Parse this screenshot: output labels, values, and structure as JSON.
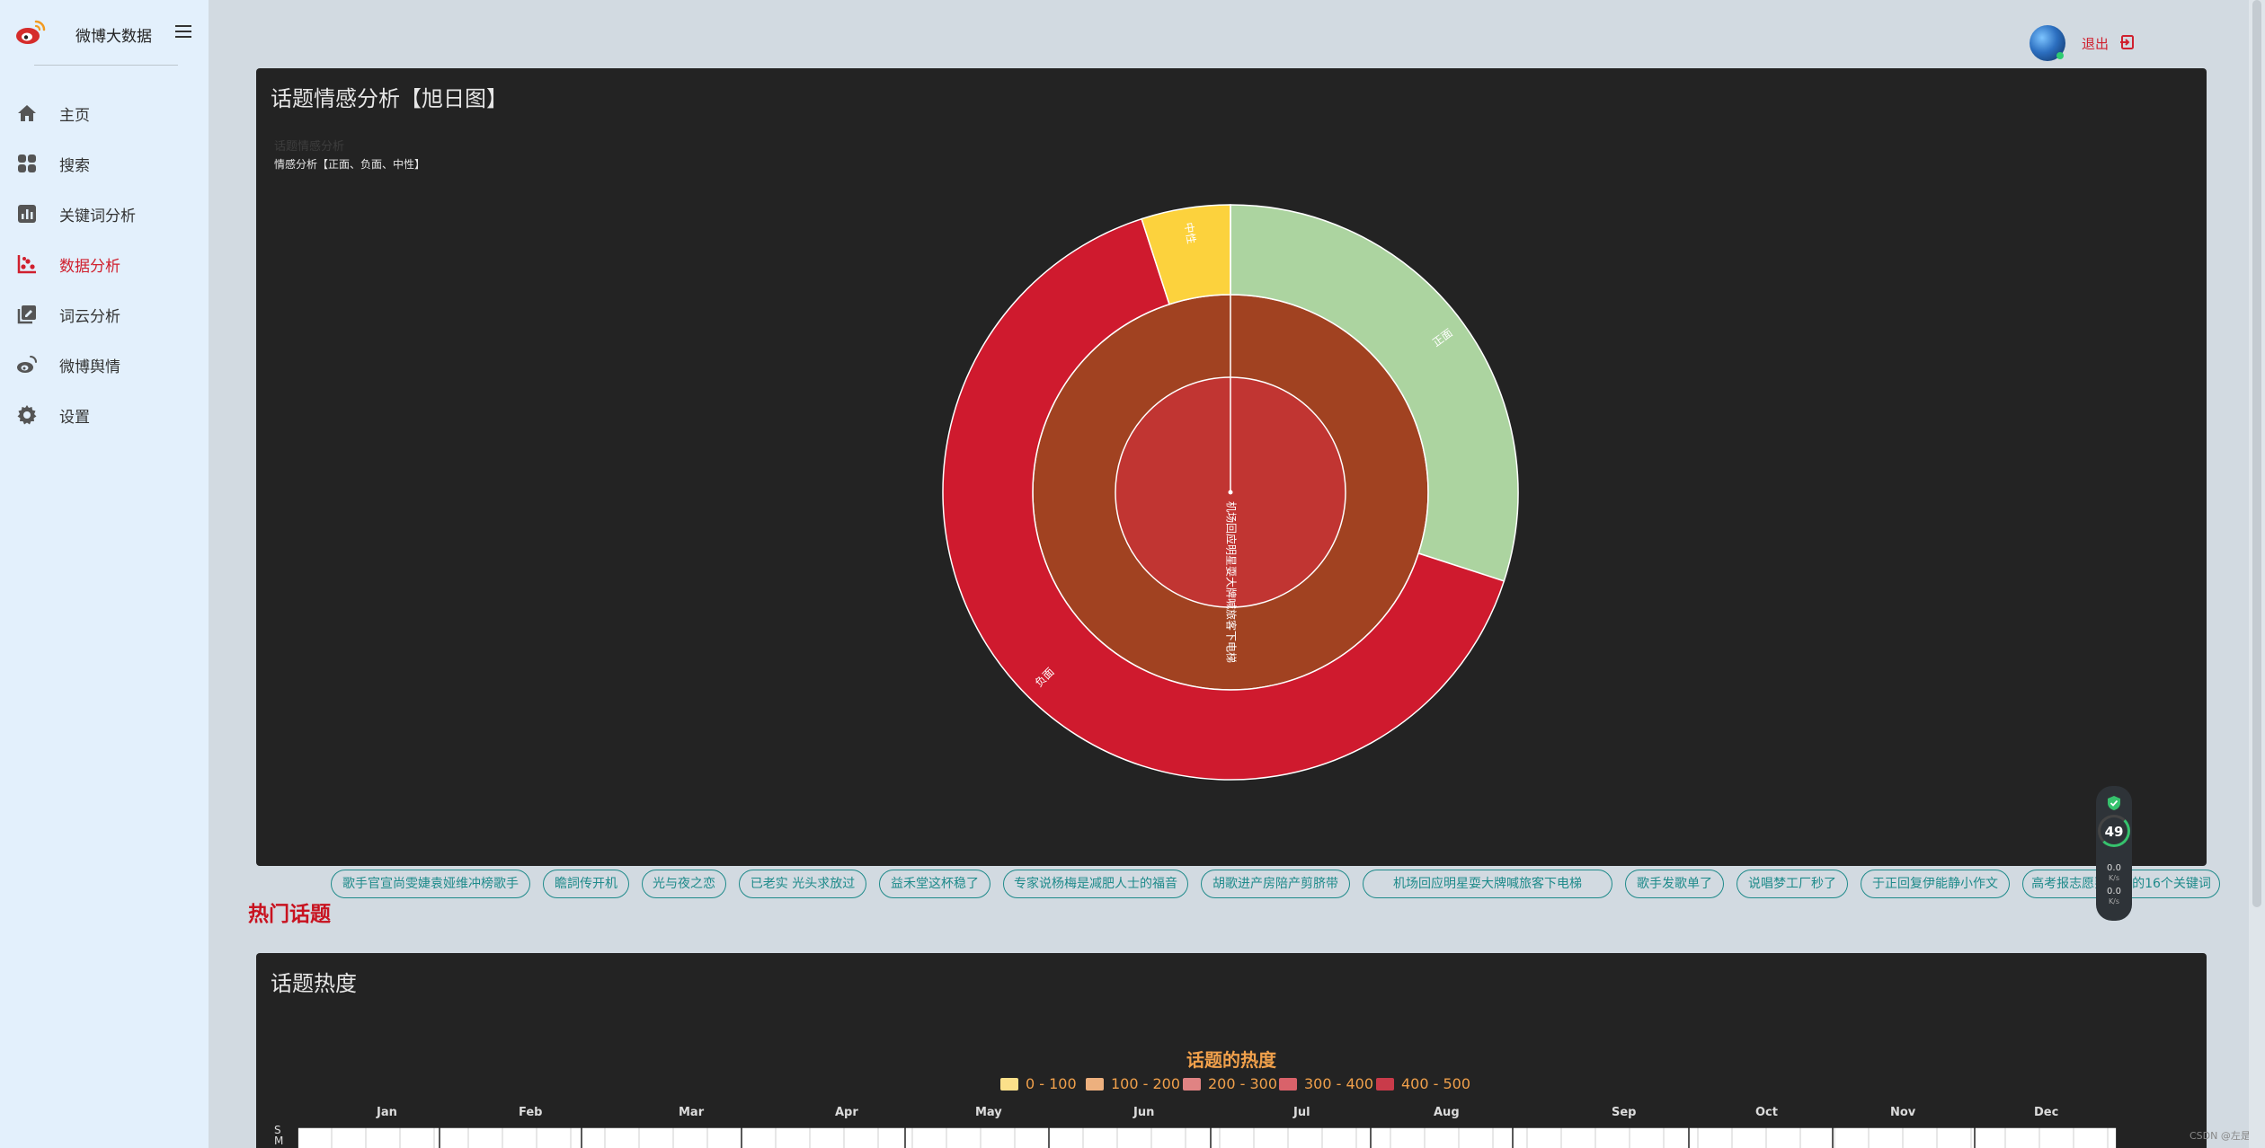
{
  "app": {
    "title": "微博大数据"
  },
  "sidebar": {
    "items": [
      {
        "label": "主页",
        "icon": "home-icon"
      },
      {
        "label": "搜索",
        "icon": "grid-icon"
      },
      {
        "label": "关键词分析",
        "icon": "bar-chart-icon"
      },
      {
        "label": "数据分析",
        "icon": "scatter-chart-icon",
        "active": true
      },
      {
        "label": "词云分析",
        "icon": "book-edit-icon"
      },
      {
        "label": "微博舆情",
        "icon": "weibo-icon"
      },
      {
        "label": "设置",
        "icon": "gear-icon"
      }
    ]
  },
  "header": {
    "logout_label": "退出"
  },
  "sunburst_panel": {
    "title": "话题情感分析【旭日图】",
    "chart_title": "话题情感分析",
    "chart_subtitle": "情感分析【正面、负面、中性】"
  },
  "hot_topics": {
    "title": "热门话题",
    "tags": [
      "歌手官宣尚雯婕袁娅维冲榜歌手",
      "瞻詞传开机",
      "光与夜之恋",
      "已老实 光头求放过",
      "益禾堂这杯稳了",
      "专家说杨梅是减肥人士的福音",
      "胡歌进产房陪产剪脐带",
      "机场回应明星耍大牌喊旅客下电梯",
      "歌手发歌单了",
      "说唱梦工厂秒了",
      "于正回复伊能静小作文",
      "高考报志愿要注意的16个关键词"
    ]
  },
  "heat_panel": {
    "title": "话题热度",
    "chart_title": "话题的热度",
    "months": [
      "Jan",
      "Feb",
      "Mar",
      "Apr",
      "May",
      "Jun",
      "Jul",
      "Aug",
      "Sep",
      "Oct",
      "Nov",
      "Dec"
    ],
    "weekdays": [
      "S",
      "M"
    ]
  },
  "monitor": {
    "percent": "49",
    "percent_unit": "%",
    "up": "0.0",
    "down": "0.0",
    "unit": "K/s"
  },
  "watermark": "CSDN @左是",
  "colors": {
    "accent": "#d0202e",
    "panel_bg": "#232323",
    "sidebar_bg": "#e3f0fc",
    "tag": "#1e8a8a"
  },
  "chart_data": [
    {
      "type": "sunburst",
      "title": "话题情感分析",
      "subtitle": "情感分析【正面、负面、中性】",
      "root": "机场回应明星耍大牌喊旅客下电梯",
      "children": [
        {
          "name": "正面",
          "value": 30,
          "color": "#acd4a0"
        },
        {
          "name": "负面",
          "value": 65,
          "color": "#cf1a2e"
        },
        {
          "name": "中性",
          "value": 5,
          "color": "#fcd23d"
        }
      ]
    },
    {
      "type": "heatmap",
      "title": "话题的热度",
      "legend": [
        {
          "label": "0 - 100",
          "color": "#fbe08a"
        },
        {
          "label": "100 - 200",
          "color": "#edb07e"
        },
        {
          "label": "200 - 300",
          "color": "#e08383"
        },
        {
          "label": "300 - 400",
          "color": "#d9626a"
        },
        {
          "label": "400 - 500",
          "color": "#c93b4a"
        }
      ],
      "months": [
        "Jan",
        "Feb",
        "Mar",
        "Apr",
        "May",
        "Jun",
        "Jul",
        "Aug",
        "Sep",
        "Oct",
        "Nov",
        "Dec"
      ]
    }
  ]
}
